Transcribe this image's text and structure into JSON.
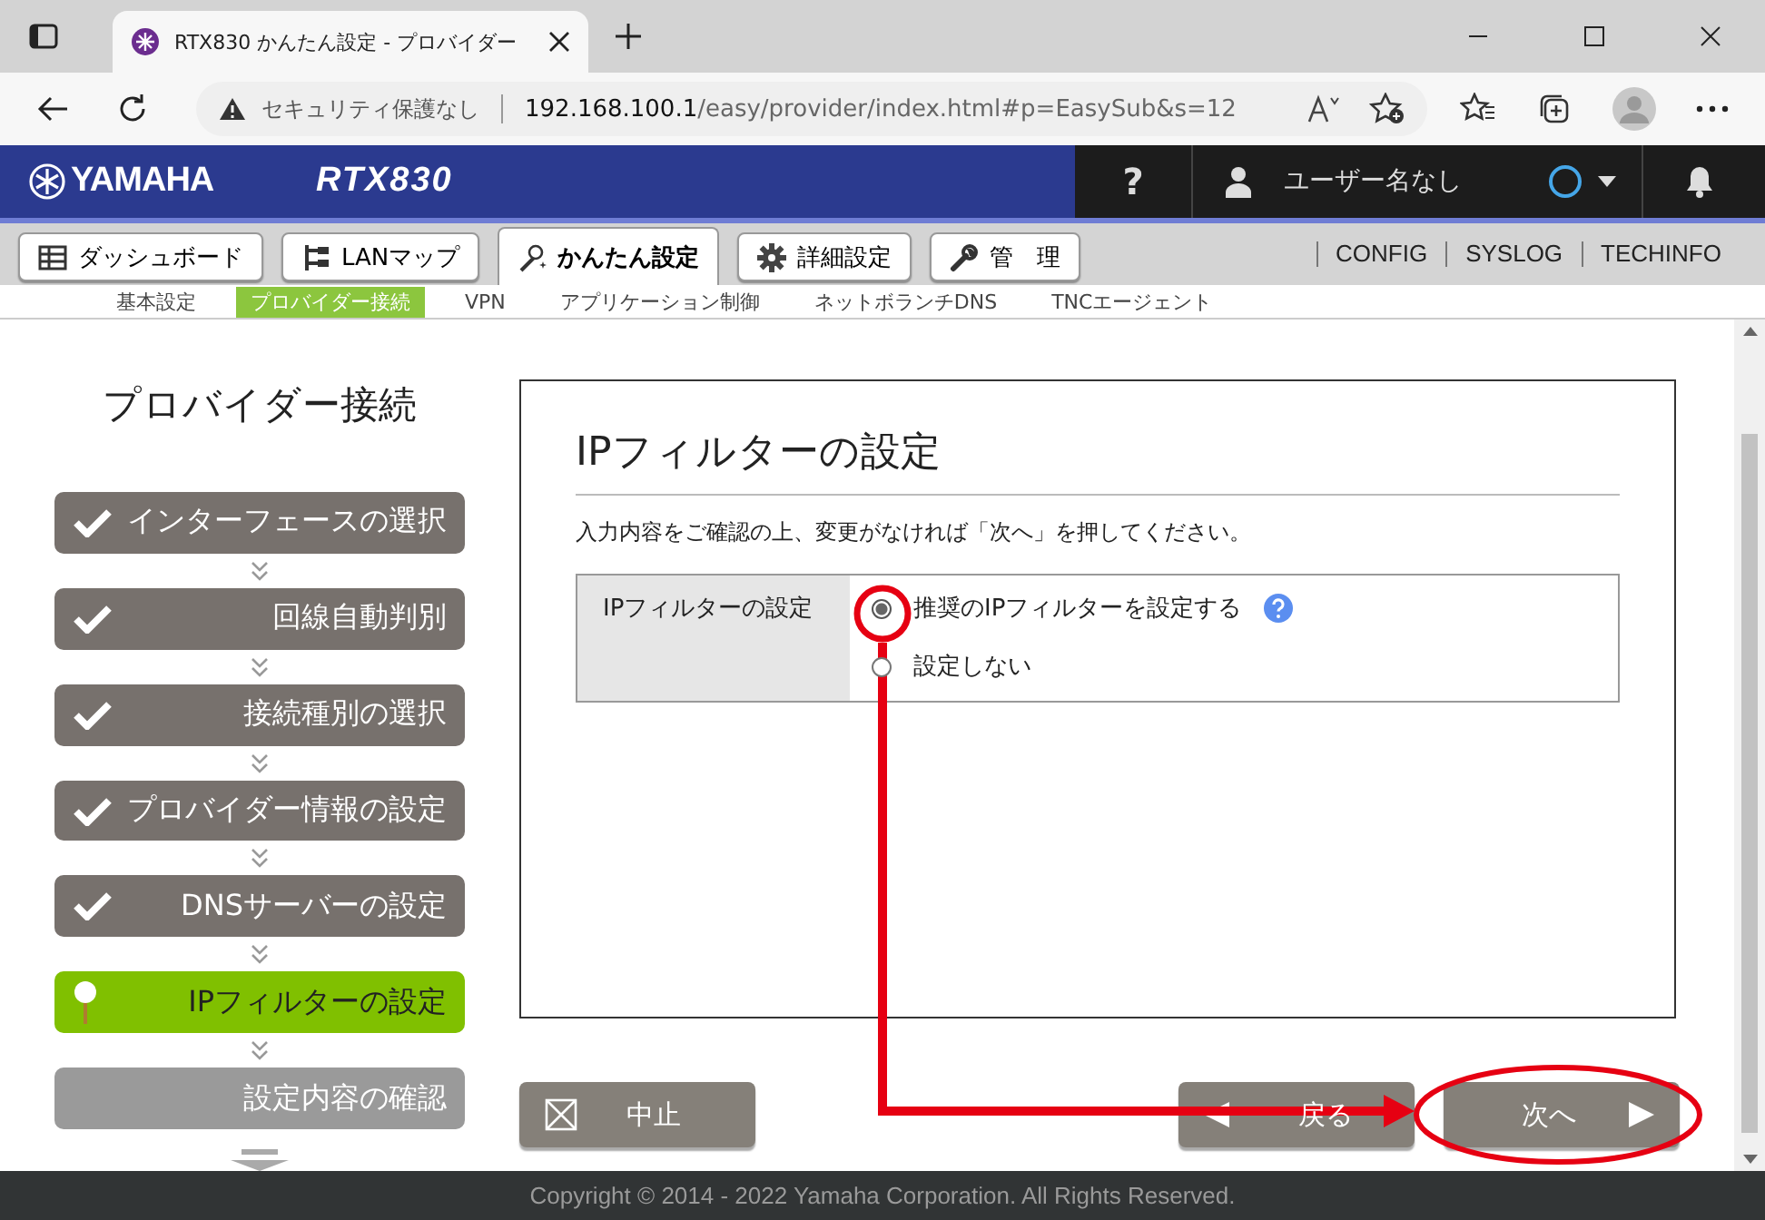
{
  "browser": {
    "tab_title": "RTX830 かんたん設定 - プロバイダー",
    "security_label": "セキュリティ保護なし",
    "url_host": "192.168.100.1",
    "url_path": "/easy/provider/index.html#p=EasySub&s=12"
  },
  "header": {
    "brand": "YAMAHA",
    "model": "RTX830",
    "help": "?",
    "user": "ユーザー名なし"
  },
  "nav": {
    "tabs": [
      {
        "label": "ダッシュボード",
        "selected": false
      },
      {
        "label": "LANマップ",
        "selected": false
      },
      {
        "label": "かんたん設定",
        "selected": true
      },
      {
        "label": "詳細設定",
        "selected": false
      },
      {
        "label": "管　理",
        "selected": false
      }
    ],
    "links": [
      "CONFIG",
      "SYSLOG",
      "TECHINFO"
    ]
  },
  "subnav": [
    {
      "label": "基本設定",
      "selected": false
    },
    {
      "label": "プロバイダー接続",
      "selected": true
    },
    {
      "label": "VPN",
      "selected": false
    },
    {
      "label": "アプリケーション制御",
      "selected": false
    },
    {
      "label": "ネットボランチDNS",
      "selected": false
    },
    {
      "label": "TNCエージェント",
      "selected": false
    }
  ],
  "sidebar": {
    "title": "プロバイダー接続",
    "steps": [
      {
        "label": "インターフェースの選択",
        "kind": "done"
      },
      {
        "label": "回線自動判別",
        "kind": "done"
      },
      {
        "label": "接続種別の選択",
        "kind": "done"
      },
      {
        "label": "プロバイダー情報の設定",
        "kind": "done"
      },
      {
        "label": "DNSサーバーの設定",
        "kind": "done"
      },
      {
        "label": "IPフィルターの設定",
        "kind": "current"
      },
      {
        "label": "設定内容の確認",
        "kind": "pending"
      }
    ]
  },
  "panel": {
    "title": "IPフィルターの設定",
    "instruction": "入力内容をご確認の上、変更がなければ「次へ」を押してください。",
    "field": {
      "label": "IPフィルターの設定",
      "options": [
        {
          "label": "推奨のIPフィルターを設定する",
          "selected": true,
          "help": true
        },
        {
          "label": "設定しない",
          "selected": false,
          "help": false
        }
      ]
    }
  },
  "buttons": {
    "cancel": "中止",
    "back": "戻る",
    "next": "次へ"
  },
  "footer": "Copyright © 2014 - 2022 Yamaha Corporation. All Rights Reserved."
}
